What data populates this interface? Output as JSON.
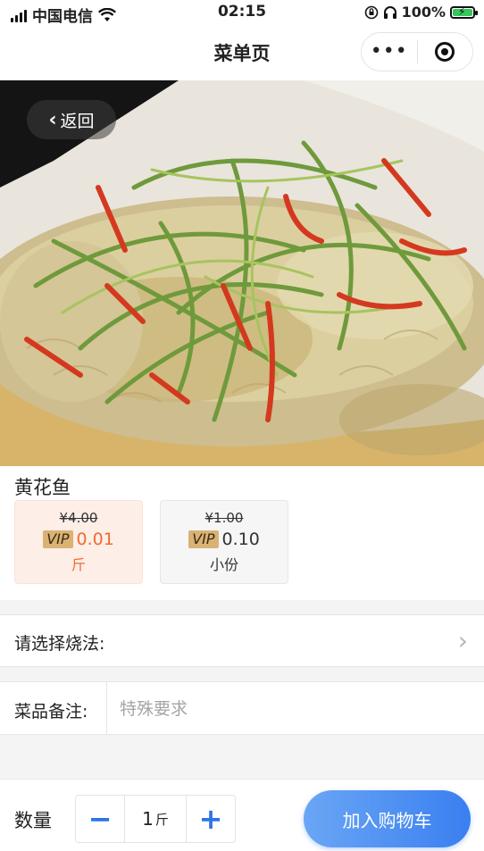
{
  "status_bar": {
    "carrier": "中国电信",
    "time": "02:15",
    "battery": "100%",
    "battery_level": 1.0
  },
  "nav": {
    "title": "菜单页",
    "more_icon": "•••"
  },
  "hero": {
    "back_label": "返回",
    "image_icon": "steamed-yellow-croaker-photo"
  },
  "product": {
    "name": "黄花鱼",
    "specs": [
      {
        "original_price": "¥4.00",
        "vip_badge": "VIP",
        "vip_price": "0.01",
        "unit": "斤",
        "selected": true
      },
      {
        "original_price": "¥1.00",
        "vip_badge": "VIP",
        "vip_price": "0.10",
        "unit": "小份",
        "selected": false
      }
    ]
  },
  "cooking": {
    "label": "请选择烧法:",
    "value": ""
  },
  "note": {
    "label": "菜品备注:",
    "placeholder": "特殊要求",
    "value": ""
  },
  "bottom": {
    "qty_label": "数量",
    "qty_value": "1",
    "qty_unit": "斤",
    "minus": "−",
    "plus": "+",
    "add_to_cart": "加入购物车"
  },
  "colors": {
    "accent_blue": "#3a7ff0",
    "price_orange": "#f26b2f",
    "vip_gold": "#d9b275",
    "selected_bg": "#fdeee7"
  }
}
